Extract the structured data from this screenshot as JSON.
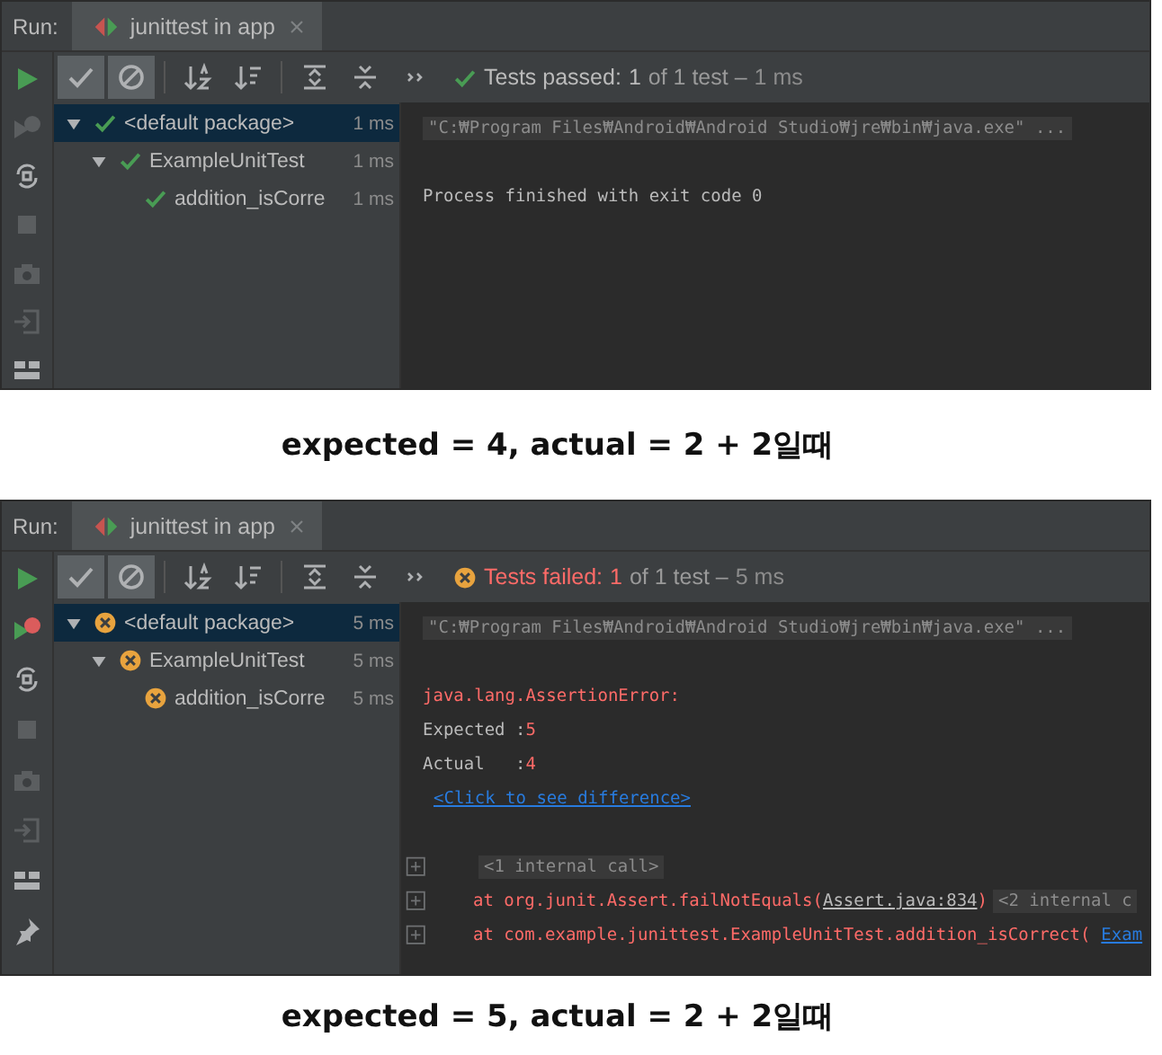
{
  "panels": [
    {
      "run_label": "Run:",
      "tab": {
        "title": "junittest in app"
      },
      "side_icons": [
        {
          "kind": "run",
          "disabled": false
        },
        {
          "kind": "rerun-failed",
          "disabled": true
        },
        {
          "kind": "toggle-auto",
          "disabled": false
        },
        {
          "kind": "stop",
          "disabled": true
        },
        {
          "kind": "camera",
          "disabled": true
        },
        {
          "kind": "exit",
          "disabled": true
        },
        {
          "kind": "layout",
          "disabled": false
        }
      ],
      "toolbar": [
        {
          "kind": "show-passed",
          "selected": true
        },
        {
          "kind": "show-ignored",
          "selected": true
        },
        {
          "kind": "sort-alpha",
          "selected": false
        },
        {
          "kind": "sort-duration",
          "selected": false
        },
        {
          "kind": "expand-all",
          "selected": false
        },
        {
          "kind": "collapse-all",
          "selected": false
        },
        {
          "kind": "more",
          "selected": false
        }
      ],
      "status": {
        "passed": true,
        "label": "Tests passed:",
        "count": "1",
        "rest": "of 1 test –",
        "duration": "1 ms"
      },
      "tree": [
        {
          "label": "<default package>",
          "time": "1 ms",
          "passed": true,
          "selected": true,
          "expanded": true,
          "children": [
            {
              "label": "ExampleUnitTest",
              "time": "1 ms",
              "passed": true,
              "selected": false,
              "expanded": true,
              "children": [
                {
                  "label": "addition_isCorre",
                  "time": "1 ms",
                  "passed": true,
                  "selected": false
                }
              ]
            }
          ]
        }
      ],
      "console": [
        {
          "fold": false,
          "segments": [
            {
              "kind": "command",
              "text": "\"C:₩Program Files₩Android₩Android Studio₩jre₩bin₩java.exe\" ..."
            }
          ]
        },
        {
          "fold": false
        },
        {
          "fold": false,
          "segments": [
            {
              "kind": "normal",
              "text": "Process finished with exit code 0"
            }
          ]
        }
      ],
      "caption": "expected = 4, actual = 2 + 2일때"
    },
    {
      "run_label": "Run:",
      "tab": {
        "title": "junittest in app"
      },
      "side_icons": [
        {
          "kind": "run",
          "disabled": false
        },
        {
          "kind": "rerun-failed",
          "disabled": false
        },
        {
          "kind": "toggle-auto",
          "disabled": false
        },
        {
          "kind": "stop",
          "disabled": true
        },
        {
          "kind": "camera",
          "disabled": true
        },
        {
          "kind": "exit",
          "disabled": true
        },
        {
          "kind": "layout",
          "disabled": false
        },
        {
          "kind": "pin",
          "disabled": false
        }
      ],
      "toolbar": [
        {
          "kind": "show-passed",
          "selected": true
        },
        {
          "kind": "show-ignored",
          "selected": true
        },
        {
          "kind": "sort-alpha",
          "selected": false
        },
        {
          "kind": "sort-duration",
          "selected": false
        },
        {
          "kind": "expand-all",
          "selected": false
        },
        {
          "kind": "collapse-all",
          "selected": false
        },
        {
          "kind": "more",
          "selected": false
        }
      ],
      "status": {
        "passed": false,
        "label": "Tests failed:",
        "count": "1",
        "rest": "of 1 test –",
        "duration": "5 ms"
      },
      "tree": [
        {
          "label": "<default package>",
          "time": "5 ms",
          "passed": false,
          "selected": true,
          "expanded": true,
          "children": [
            {
              "label": "ExampleUnitTest",
              "time": "5 ms",
              "passed": false,
              "selected": false,
              "expanded": true,
              "children": [
                {
                  "label": "addition_isCorre",
                  "time": "5 ms",
                  "passed": false,
                  "selected": false
                }
              ]
            }
          ]
        }
      ],
      "console": [
        {
          "fold": false,
          "segments": [
            {
              "kind": "command",
              "text": "\"C:₩Program Files₩Android₩Android Studio₩jre₩bin₩java.exe\" ..."
            }
          ]
        },
        {
          "fold": false
        },
        {
          "fold": false,
          "segments": [
            {
              "kind": "error",
              "text": "java.lang.AssertionError:"
            }
          ]
        },
        {
          "fold": false,
          "segments": [
            {
              "kind": "normal",
              "text": "Expected :"
            },
            {
              "kind": "error",
              "text": "5"
            }
          ]
        },
        {
          "fold": false,
          "segments": [
            {
              "kind": "normal",
              "text": "Actual   :"
            },
            {
              "kind": "error",
              "text": "4"
            }
          ]
        },
        {
          "fold": false,
          "segments": [
            {
              "kind": "link",
              "text": "<Click to see difference>"
            }
          ]
        },
        {
          "fold": false
        },
        {
          "fold": true,
          "segments": [
            {
              "kind": "collapsed",
              "text": "<1 internal call>"
            }
          ]
        },
        {
          "fold": true,
          "segments": [
            {
              "kind": "error",
              "text": "at org.junit.Assert.failNotEquals("
            },
            {
              "kind": "file",
              "text": "Assert.java:834"
            },
            {
              "kind": "error",
              "text": ")"
            },
            {
              "kind": "collapsed",
              "text": "<2 internal c"
            }
          ]
        },
        {
          "fold": true,
          "segments": [
            {
              "kind": "error",
              "text": "at com.example.junittest.ExampleUnitTest.addition_isCorrect("
            },
            {
              "kind": "link",
              "text": "Exam"
            }
          ]
        }
      ],
      "caption": "expected = 5, actual = 2 + 2일때"
    }
  ]
}
